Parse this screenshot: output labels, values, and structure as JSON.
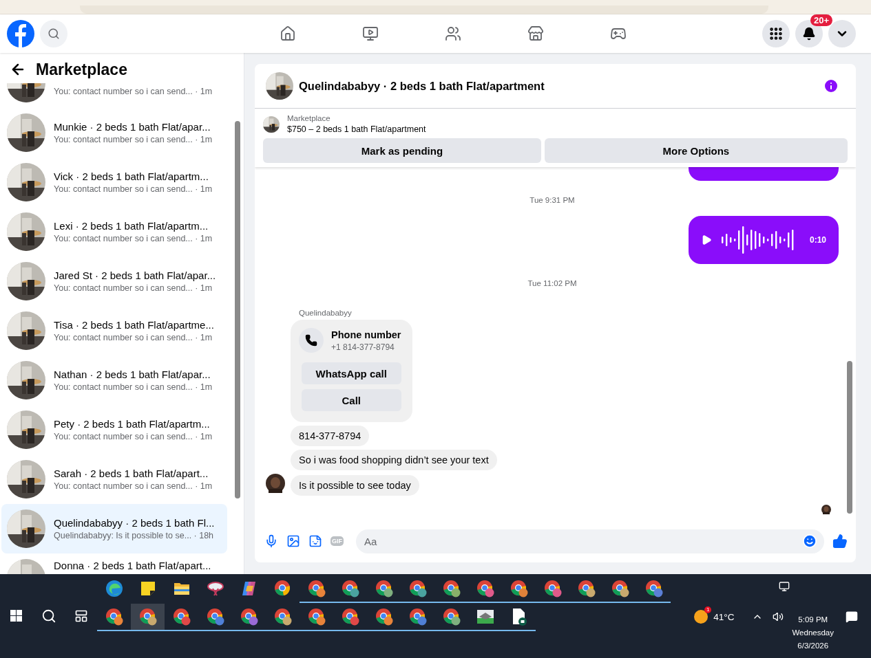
{
  "header": {
    "notification_badge": "20+",
    "nav": [
      {
        "kind": "home"
      },
      {
        "kind": "video"
      },
      {
        "kind": "friends"
      },
      {
        "kind": "marketplace"
      },
      {
        "kind": "gaming"
      }
    ]
  },
  "sidebar": {
    "title": "Marketplace",
    "conversations": [
      {
        "kind": "cut-top",
        "preview": "You: contact number so i can send... · 1m",
        "selected": false
      },
      {
        "kind": "full",
        "name": "Munkie · 2 beds 1 bath Flat/apar...",
        "preview": "You: contact number so i can send... · 1m",
        "selected": false
      },
      {
        "kind": "full",
        "name": "Vick · 2 beds 1 bath Flat/apartm...",
        "preview": "You: contact number so i can send... · 1m",
        "selected": false
      },
      {
        "kind": "full",
        "name": "Lexi · 2 beds 1 bath Flat/apartm...",
        "preview": "You: contact number so i can send... · 1m",
        "selected": false
      },
      {
        "kind": "full",
        "name": "Jared St · 2 beds 1 bath Flat/apar...",
        "preview": "You: contact number so i can send... · 1m",
        "selected": false
      },
      {
        "kind": "full",
        "name": "Tisa · 2 beds 1 bath Flat/apartme...",
        "preview": "You: contact number so i can send... · 1m",
        "selected": false
      },
      {
        "kind": "full",
        "name": "Nathan · 2 beds 1 bath Flat/apar...",
        "preview": "You: contact number so i can send... · 1m",
        "selected": false
      },
      {
        "kind": "full",
        "name": "Pety · 2 beds 1 bath Flat/apartm...",
        "preview": "You: contact number so i can send... · 1m",
        "selected": false
      },
      {
        "kind": "full",
        "name": "Sarah · 2 beds 1 bath Flat/apart...",
        "preview": "You: contact number so i can send... · 1m",
        "selected": false
      },
      {
        "kind": "full",
        "name": "Quelindababyy · 2 beds 1 bath Fl...",
        "preview": "Quelindababyy: Is it possible to se... · 18h",
        "selected": true
      },
      {
        "kind": "cut-bottom",
        "name": "Donna · 2 beds 1 bath Flat/apart...",
        "selected": false
      }
    ]
  },
  "chat": {
    "title": "Quelindababyy · 2 beds 1 bath Flat/apartment",
    "listing": {
      "source": "Marketplace",
      "summary": "$750 – 2 beds 1 bath Flat/apartment"
    },
    "actions": [
      "Mark as pending",
      "More Options"
    ],
    "messages": [
      {
        "kind": "voice-cut"
      },
      {
        "kind": "timestamp",
        "text": "Tue 9:31 PM"
      },
      {
        "kind": "voice",
        "duration": "0:10"
      },
      {
        "kind": "timestamp",
        "text": "Tue 11:02 PM"
      },
      {
        "kind": "sender",
        "text": "Quelindababyy"
      },
      {
        "kind": "contact",
        "title": "Phone number",
        "number": "+1 814-377-8794",
        "buttons": [
          "WhatsApp call",
          "Call"
        ]
      },
      {
        "kind": "text",
        "text": "814-377-8794",
        "avatar": false
      },
      {
        "kind": "text",
        "text": "So i was food shopping didn’t see your text",
        "avatar": false
      },
      {
        "kind": "text",
        "text": "Is it possible to see today",
        "avatar": true
      }
    ],
    "composer": {
      "gif_label": "GIF",
      "placeholder": "Aa"
    }
  },
  "taskbar": {
    "rows": [
      [
        {
          "kind": "edge",
          "running": false,
          "selected": false
        },
        {
          "kind": "notes",
          "running": false,
          "selected": false
        },
        {
          "kind": "folder",
          "running": false,
          "selected": false
        },
        {
          "kind": "snip",
          "running": false,
          "selected": false
        },
        {
          "kind": "copilot",
          "running": false,
          "selected": false
        },
        {
          "kind": "chrome",
          "running": false,
          "selected": false
        },
        {
          "kind": "chrome-profile",
          "color": "#e8833a",
          "running": true,
          "selected": false
        },
        {
          "kind": "chrome-profile",
          "color": "#4aa3a0",
          "running": true,
          "selected": false
        },
        {
          "kind": "chrome-profile",
          "color": "#7fb07f",
          "running": true,
          "selected": false
        },
        {
          "kind": "chrome-profile",
          "color": "#4aa3a0",
          "running": true,
          "selected": false
        },
        {
          "kind": "chrome-profile",
          "color": "#88b06a",
          "running": true,
          "selected": false
        },
        {
          "kind": "chrome-profile",
          "color": "#e05a8a",
          "running": true,
          "selected": false
        },
        {
          "kind": "chrome-profile",
          "color": "#e0823a",
          "running": true,
          "selected": false
        },
        {
          "kind": "chrome-profile",
          "color": "#e05a8a",
          "running": true,
          "selected": false
        },
        {
          "kind": "chrome-profile",
          "color": "#c9a96e",
          "running": true,
          "selected": false
        },
        {
          "kind": "chrome-profile",
          "color": "#c9a96e",
          "running": true,
          "selected": false
        },
        {
          "kind": "chrome-profile",
          "color": "#5b7fd6",
          "running": true,
          "selected": false
        }
      ],
      [
        {
          "kind": "chrome-profile",
          "color": "#e8833a",
          "running": true,
          "selected": false
        },
        {
          "kind": "chrome-profile",
          "color": "#c9a96e",
          "running": true,
          "selected": true
        },
        {
          "kind": "chrome-profile",
          "color": "#e04848",
          "running": true,
          "selected": false
        },
        {
          "kind": "chrome-profile",
          "color": "#4f7fd6",
          "running": true,
          "selected": false
        },
        {
          "kind": "chrome-profile",
          "color": "#9a6ad6",
          "running": true,
          "selected": false
        },
        {
          "kind": "chrome-profile",
          "color": "#c9a96e",
          "running": true,
          "selected": false
        },
        {
          "kind": "chrome-profile",
          "color": "#e8833a",
          "running": true,
          "selected": false
        },
        {
          "kind": "chrome-profile",
          "color": "#e04848",
          "running": true,
          "selected": false
        },
        {
          "kind": "chrome-profile",
          "color": "#e8833a",
          "running": true,
          "selected": false
        },
        {
          "kind": "chrome-profile",
          "color": "#4f7fd6",
          "running": true,
          "selected": false
        },
        {
          "kind": "chrome-profile",
          "color": "#7fb07f",
          "running": true,
          "selected": false
        },
        {
          "kind": "photo-viewer",
          "running": true,
          "selected": false
        },
        {
          "kind": "document",
          "running": true,
          "selected": false
        }
      ]
    ],
    "weather": {
      "badge": "1",
      "temperature": "41°C"
    },
    "clock": {
      "time": "5:09 PM",
      "day": "Wednesday",
      "date": "6/3/2026"
    }
  }
}
